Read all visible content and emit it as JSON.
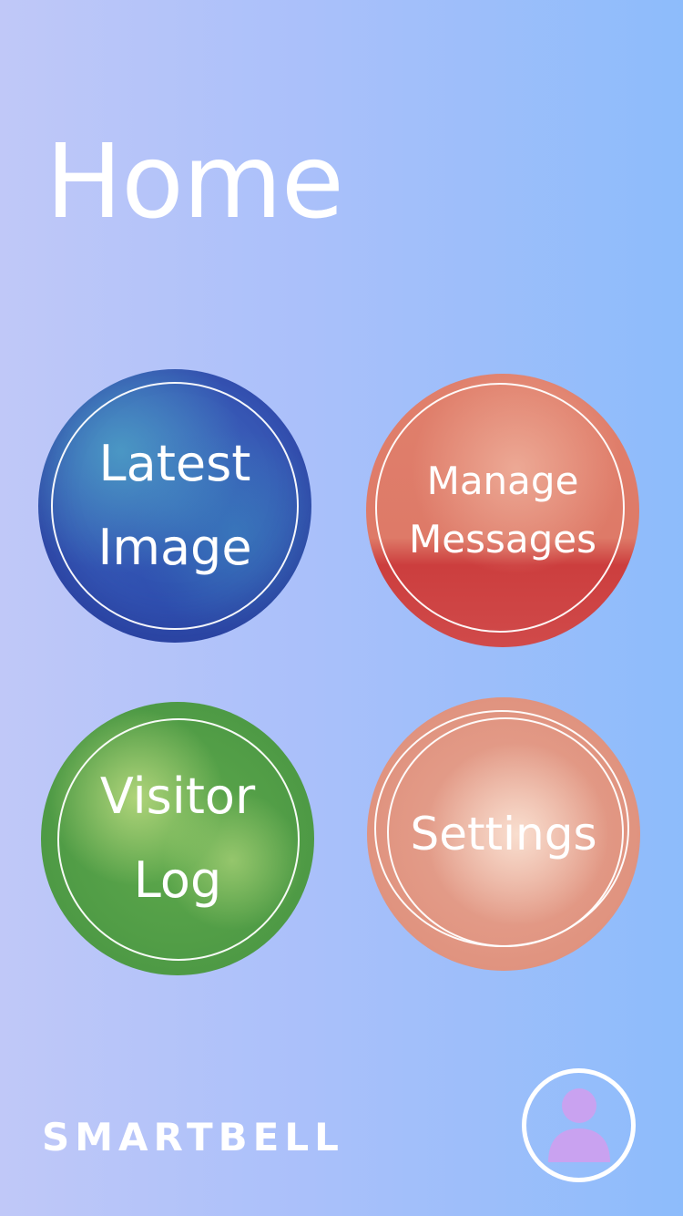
{
  "page": {
    "title": "Home"
  },
  "tiles": [
    {
      "id": "latest-image",
      "lines": [
        "Latest",
        "Image"
      ],
      "color": "#3552b2"
    },
    {
      "id": "manage-messages",
      "lines": [
        "Manage",
        "Messages"
      ],
      "color": "#de7a68"
    },
    {
      "id": "visitor-log",
      "lines": [
        "Visitor",
        "Log"
      ],
      "color": "#5ea94c"
    },
    {
      "id": "settings",
      "lines": [
        "Settings"
      ],
      "color": "#e0937f"
    }
  ],
  "brand": {
    "name": "SMARTBELL"
  },
  "profile": {
    "icon": "person-icon",
    "color": "#c9a2f0"
  }
}
